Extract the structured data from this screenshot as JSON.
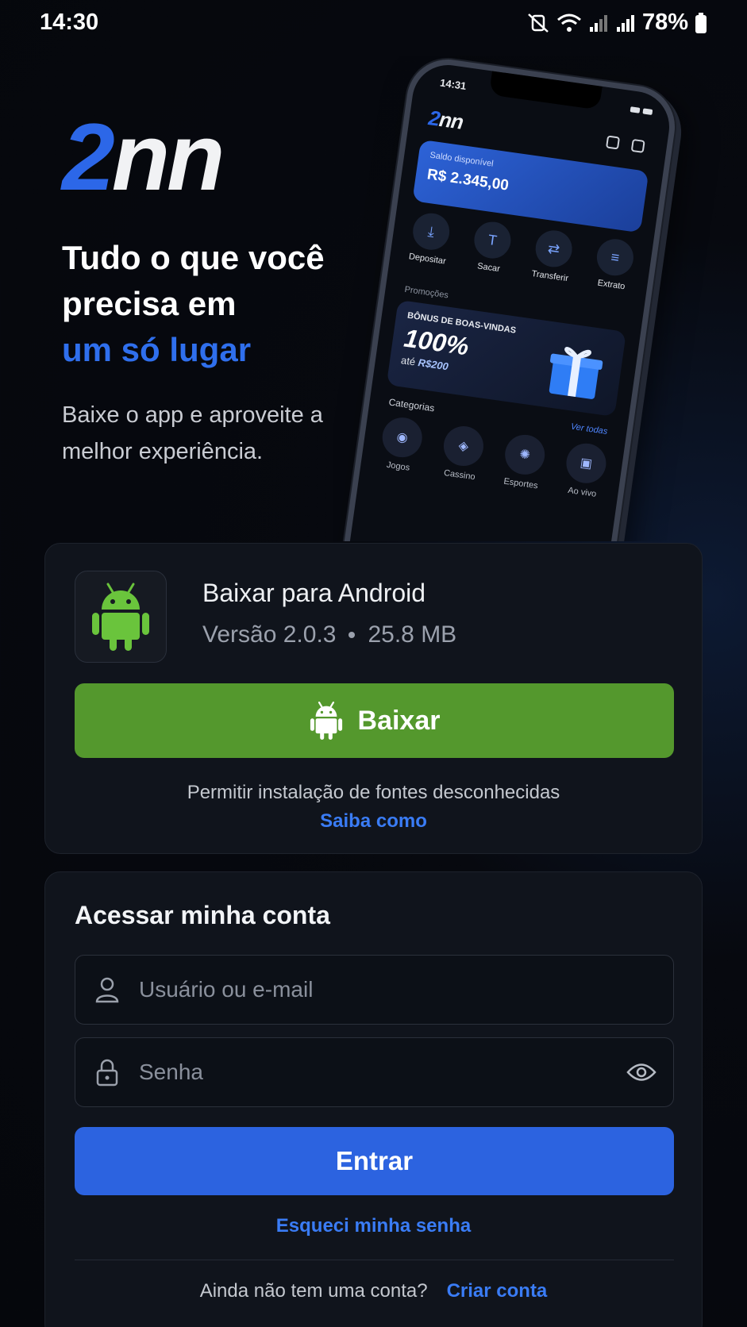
{
  "status_bar": {
    "time": "14:30",
    "battery": "78%",
    "icons": [
      "mute-vibrate-icon",
      "wifi-icon",
      "signal-icon",
      "signal-icon",
      "battery-icon"
    ]
  },
  "brand": {
    "logo_part1": "2",
    "logo_part2": "nn",
    "accent_color": "#2c67e8"
  },
  "hero": {
    "line1": "Tudo o que você",
    "line2": "precisa em",
    "accent": "um só lugar",
    "subtitle": "Baixe o app e aproveite a melhor experiência."
  },
  "phone_mockup": {
    "time": "14:31",
    "logo_part1": "2",
    "logo_part2": "nn",
    "balance_label": "Saldo disponível",
    "balance_value": "R$ 2.345,00",
    "actions": [
      "Depositar",
      "Sacar",
      "Transferir",
      "Extrato"
    ],
    "promo_section": "Promoções",
    "promo_heading": "BÔNUS DE BOAS-VINDAS",
    "promo_big": "100%",
    "promo_sub_prefix": "até",
    "promo_sub_value": "R$200",
    "categories_title": "Categorias",
    "categories_link": "Ver todas",
    "categories": [
      "Jogos",
      "Cassino",
      "Esportes",
      "Ao vivo"
    ]
  },
  "download": {
    "title": "Baixar para Android",
    "version": "Versão 2.0.3",
    "size": "25.8 MB",
    "button_label": "Baixar",
    "button_color": "#54982d",
    "note": "Permitir instalação de fontes desconhecidas",
    "link": "Saiba como"
  },
  "login": {
    "title": "Acessar minha conta",
    "username_placeholder": "Usuário ou e-mail",
    "password_placeholder": "Senha",
    "submit_label": "Entrar",
    "submit_color": "#2c63e0",
    "forgot": "Esqueci minha senha",
    "no_account": "Ainda não tem uma conta?",
    "create_account": "Criar conta"
  }
}
